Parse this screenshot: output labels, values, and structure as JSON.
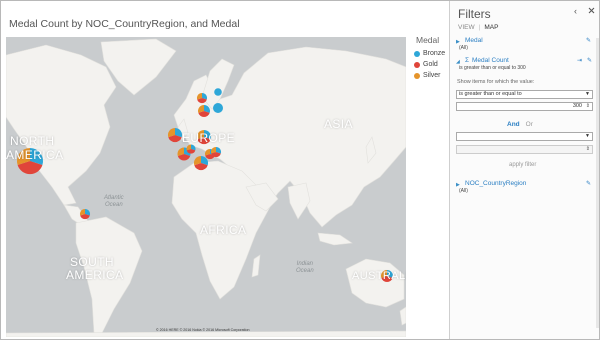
{
  "visual": {
    "title": "Medal Count by NOC_CountryRegion, and Medal"
  },
  "map": {
    "regions": {
      "north_america": [
        "NORTH",
        "AMERICA"
      ],
      "europe": "EUROPE",
      "asia": "ASIA",
      "africa": "AFRICA",
      "south_america": [
        "SOUTH",
        "AMERICA"
      ],
      "australia": "AUSTRALIA"
    },
    "oceans": {
      "atlantic": [
        "Atlantic",
        "Ocean"
      ],
      "indian": [
        "Indian",
        "Ocean"
      ]
    },
    "copyright": "© 2016 HERE  © 2016 Nokia  © 2016 Microsoft Corporation",
    "colors": {
      "bronze": "#2ea7d8",
      "gold": "#e0453a",
      "silver": "#e5942b",
      "land": "#f3f2ef",
      "water": "#c9ccce"
    }
  },
  "legend": {
    "title": "Medal",
    "items": [
      {
        "label": "Bronze",
        "color": "#2ea7d8"
      },
      {
        "label": "Gold",
        "color": "#e0453a"
      },
      {
        "label": "Silver",
        "color": "#e5942b"
      }
    ]
  },
  "filters": {
    "title": "Filters",
    "controls": {
      "back": "‹",
      "close": "‹"
    },
    "tabs": {
      "view": "VIEW",
      "map": "MAP"
    },
    "medal": {
      "field": "Medal",
      "value": "(All)"
    },
    "medal_count": {
      "field": "Medal Count",
      "summary": "is greater than or equal to 300",
      "show_items_label": "Show items for which the value:",
      "operator": "is greater than or equal to",
      "threshold": "300",
      "operator2": "",
      "value2": ""
    },
    "logic": {
      "and": "And",
      "or": "Or"
    },
    "apply_label": "apply filter",
    "noc": {
      "field": "NOC_CountryRegion",
      "value": "(All)"
    }
  }
}
